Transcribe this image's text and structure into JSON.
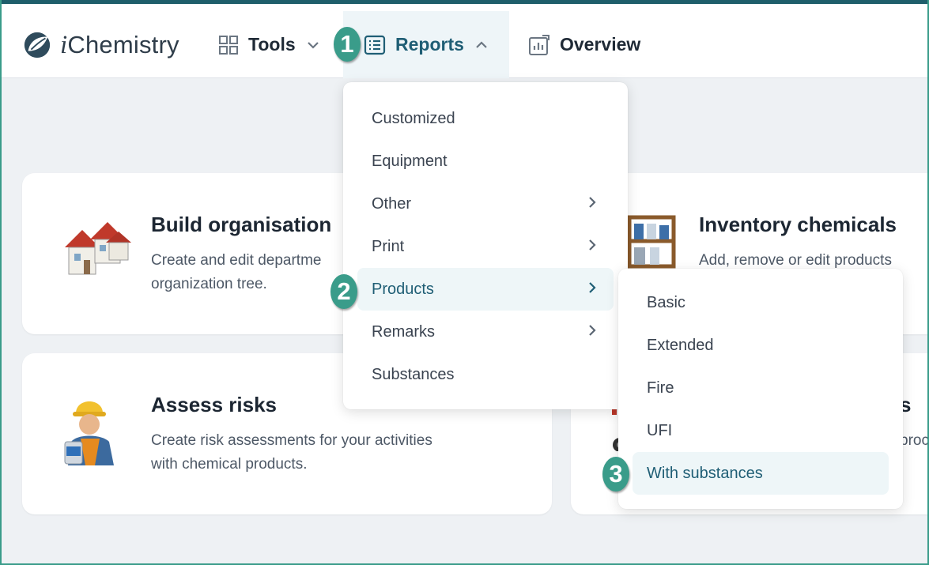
{
  "app": {
    "logo_text": "Chemistry",
    "logo_i": "i"
  },
  "nav": {
    "tools": "Tools",
    "reports": "Reports",
    "overview": "Overview"
  },
  "reports_menu": {
    "items": [
      {
        "label": "Customized",
        "has_submenu": false
      },
      {
        "label": "Equipment",
        "has_submenu": false
      },
      {
        "label": "Other",
        "has_submenu": true
      },
      {
        "label": "Print",
        "has_submenu": true
      },
      {
        "label": "Products",
        "has_submenu": true,
        "active": true
      },
      {
        "label": "Remarks",
        "has_submenu": true
      },
      {
        "label": "Substances",
        "has_submenu": false
      }
    ]
  },
  "products_submenu": {
    "items": [
      {
        "label": "Basic"
      },
      {
        "label": "Extended"
      },
      {
        "label": "Fire"
      },
      {
        "label": "UFI"
      },
      {
        "label": "With substances",
        "active": true
      }
    ]
  },
  "cards": {
    "build": {
      "title": "Build organisation",
      "desc1": "Create and edit departme",
      "desc2": "organization tree."
    },
    "inventory": {
      "title": "Inventory chemicals",
      "desc1": "Add, remove or edit products"
    },
    "assess": {
      "title": "Assess risks",
      "desc1": "Create risk assessments for your activities",
      "desc2": "with chemical products."
    },
    "fourth": {
      "title_fragment": "s",
      "desc_fragment": "proc"
    }
  },
  "badges": {
    "one": "1",
    "two": "2",
    "three": "3"
  },
  "colors": {
    "accent": "#3a9c8a",
    "header_line": "#1f5e6b",
    "active_bg": "#eef6f8"
  }
}
